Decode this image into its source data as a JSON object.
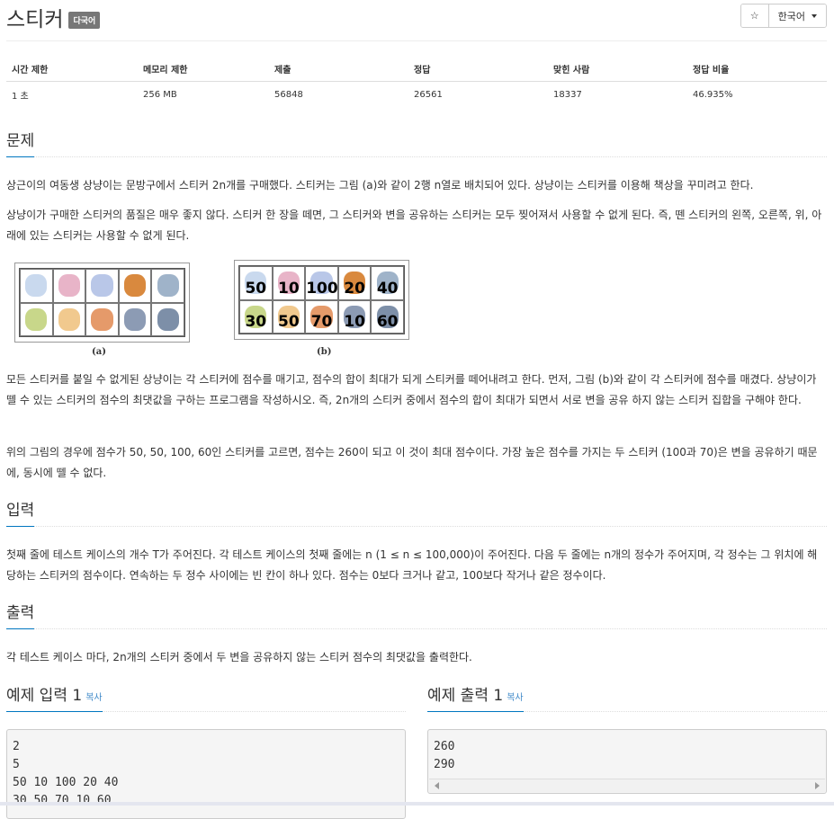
{
  "problem": {
    "title": "스티커",
    "badge": "다국어",
    "star": "☆",
    "language": "한국어"
  },
  "info_table": {
    "headers": [
      "시간 제한",
      "메모리 제한",
      "제출",
      "정답",
      "맞힌 사람",
      "정답 비율"
    ],
    "values": [
      "1 초",
      "256 MB",
      "56848",
      "26561",
      "18337",
      "46.935%"
    ]
  },
  "sections": {
    "problem": "문제",
    "input": "입력",
    "output": "출력",
    "sample_input": "예제 입력 1",
    "sample_output": "예제 출력 1",
    "copy": "복사"
  },
  "problem_text": {
    "p1": "상근이의 여동생 상냥이는 문방구에서 스티커 2n개를 구매했다. 스티커는 그림 (a)와 같이 2행 n열로 배치되어 있다. 상냥이는 스티커를 이용해 책상을 꾸미려고 한다.",
    "p2": "상냥이가 구매한 스티커의 품질은 매우 좋지 않다. 스티커 한 장을 떼면, 그 스티커와 변을 공유하는 스티커는 모두 찢어져서 사용할 수 없게 된다. 즉, 뗀 스티커의 왼쪽, 오른쪽, 위, 아래에 있는 스티커는 사용할 수 없게 된다.",
    "p3": "모든 스티커를 붙일 수 없게된 상냥이는 각 스티커에 점수를 매기고, 점수의 합이 최대가 되게 스티커를 떼어내려고 한다. 먼저, 그림 (b)와 같이 각 스티커에 점수를 매겼다. 상냥이가 뗄 수 있는 스티커의 점수의 최댓값을 구하는 프로그램을 작성하시오. 즉, 2n개의 스티커 중에서 점수의 합이 최대가 되면서 서로 변을 공유 하지 않는 스티커 집합을 구해야 한다.",
    "p4": "위의 그림의 경우에 점수가 50, 50, 100, 60인 스티커를 고르면, 점수는 260이 되고 이 것이 최대 점수이다. 가장 높은 점수를 가지는 두 스티커 (100과 70)은 변을 공유하기 때문에, 동시에 뗄 수 없다."
  },
  "figure": {
    "label_a": "(a)",
    "label_b": "(b)",
    "scores_top": [
      "50",
      "10",
      "100",
      "20",
      "40"
    ],
    "scores_bottom": [
      "30",
      "50",
      "70",
      "10",
      "60"
    ]
  },
  "input_text": "첫째 줄에 테스트 케이스의 개수 T가 주어진다. 각 테스트 케이스의 첫째 줄에는 n (1 ≤ n ≤ 100,000)이 주어진다. 다음 두 줄에는 n개의 정수가 주어지며, 각 정수는 그 위치에 해당하는 스티커의 점수이다. 연속하는 두 정수 사이에는 빈 칸이 하나 있다. 점수는 0보다 크거나 같고, 100보다 작거나 같은 정수이다.",
  "output_text": "각 테스트 케이스 마다, 2n개의 스티커 중에서 두 변을 공유하지 않는 스티커 점수의 최댓값을 출력한다.",
  "sample_input_lines": [
    "2",
    "5",
    "50 10 100 20 40",
    "30 50 70 10 60"
  ],
  "sample_output_lines": [
    "260",
    "290"
  ]
}
